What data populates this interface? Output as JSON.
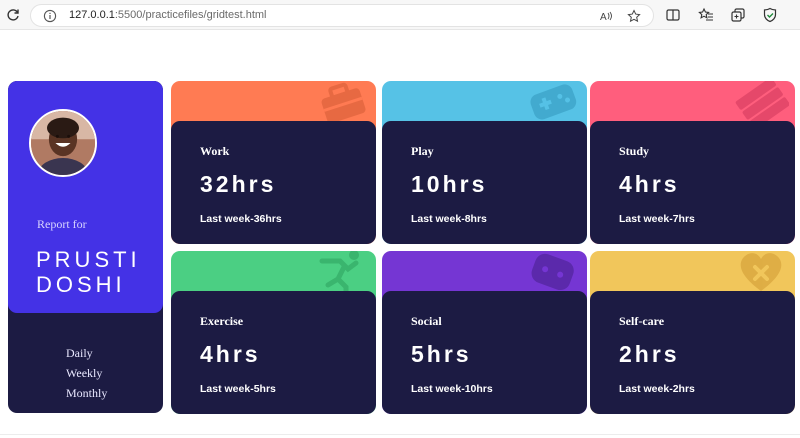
{
  "browser": {
    "url_host": "127.0.0.1",
    "url_path": ":5500/practicefiles/gridtest.html",
    "icons": [
      "reload-icon",
      "info-icon",
      "read-aloud-icon",
      "favorite-star-icon",
      "split-screen-icon",
      "favorites-icon",
      "collections-icon",
      "browser-essentials-icon"
    ]
  },
  "profile": {
    "report_for": "Report for",
    "name_line1": "PRUSTI",
    "name_line2": "DOSHI",
    "periods": [
      "Daily",
      "Weekly",
      "Monthly"
    ]
  },
  "cards": [
    {
      "title": "Work",
      "hours": "32hrs",
      "previous": "Last week-36hrs",
      "color": "#ff7b53",
      "icon": "briefcase-icon"
    },
    {
      "title": "Play",
      "hours": "10hrs",
      "previous": "Last week-8hrs",
      "color": "#56c2e6",
      "icon": "gamepad-icon"
    },
    {
      "title": "Study",
      "hours": "4hrs",
      "previous": "Last week-7hrs",
      "color": "#ff5e7d",
      "icon": "books-icon"
    },
    {
      "title": "Exercise",
      "hours": "4hrs",
      "previous": "Last week-5hrs",
      "color": "#4bcf83",
      "icon": "running-icon"
    },
    {
      "title": "Social",
      "hours": "5hrs",
      "previous": "Last week-10hrs",
      "color": "#7536d3",
      "icon": "social-icon"
    },
    {
      "title": "Self-care",
      "hours": "2hrs",
      "previous": "Last week-2hrs",
      "color": "#f1c65b",
      "icon": "heart-icon"
    }
  ]
}
